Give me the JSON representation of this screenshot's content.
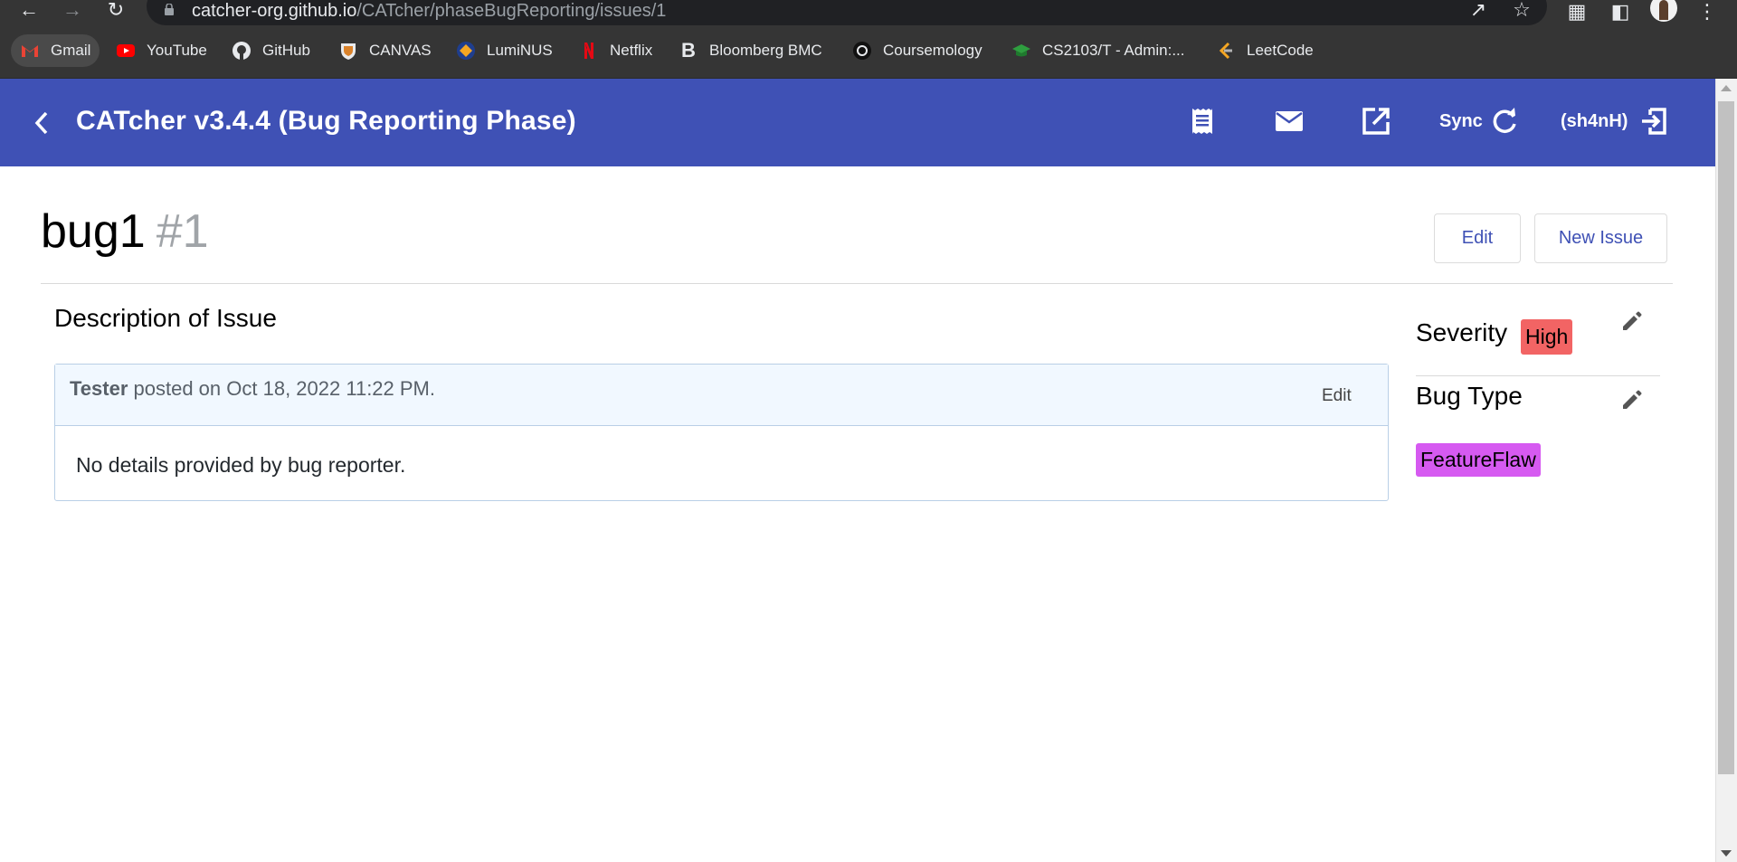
{
  "browser": {
    "url_host": "catcher-org.github.io",
    "url_path": "/CATcher/phaseBugReporting/issues/1",
    "bookmarks": [
      {
        "label": "Gmail",
        "icon": "gmail-icon"
      },
      {
        "label": "YouTube",
        "icon": "youtube-icon"
      },
      {
        "label": "GitHub",
        "icon": "github-icon"
      },
      {
        "label": "CANVAS",
        "icon": "canvas-icon"
      },
      {
        "label": "LumiNUS",
        "icon": "luminus-icon"
      },
      {
        "label": "Netflix",
        "icon": "netflix-icon"
      },
      {
        "label": "Bloomberg BMC",
        "icon": "bloomberg-icon"
      },
      {
        "label": "Coursemology",
        "icon": "coursemology-icon"
      },
      {
        "label": "CS2103/T - Admin:...",
        "icon": "cs2103-icon"
      },
      {
        "label": "LeetCode",
        "icon": "leetcode-icon"
      }
    ]
  },
  "app_bar": {
    "title": "CATcher v3.4.4  (Bug Reporting Phase)",
    "sync_label": "Sync",
    "user_label": "(sh4nH)",
    "color": "#3f51b5"
  },
  "issue": {
    "title": "bug1",
    "number": "#1",
    "edit_label": "Edit",
    "new_issue_label": "New Issue",
    "description_heading": "Description of Issue",
    "comment": {
      "author": "Tester",
      "posted_text": " posted on Oct 18, 2022 11:22 PM.",
      "edit_label": "Edit",
      "body": "No details provided by bug reporter."
    },
    "severity": {
      "label": "Severity",
      "value": "High",
      "color": "#f26464"
    },
    "bug_type": {
      "label": "Bug Type",
      "value": "FeatureFlaw",
      "color": "#d65af1"
    }
  }
}
